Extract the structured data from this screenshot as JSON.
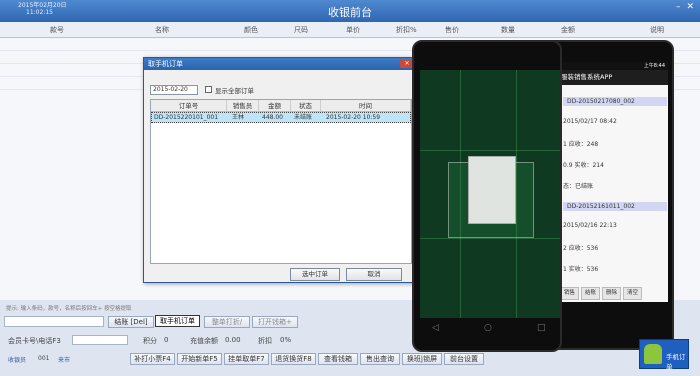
{
  "window": {
    "date": "2015年02月20日",
    "time": "11:02:15",
    "title": "收银前台"
  },
  "grid": {
    "columns": [
      "款号",
      "名称",
      "颜色",
      "尺码",
      "单价",
      "折扣%",
      "售价",
      "数量",
      "金额",
      "说明"
    ]
  },
  "footer": {
    "search_hint": "提示: 输入条码，款号，名称后按回车+ 按空格提取",
    "btn_settle": "结账 [Del]",
    "btn_fetch_mobile": "取手机订单",
    "btn_discount": "整单打折/",
    "btn_open_drawer": "打开钱箱+",
    "member_label": "会员卡号\\电话F3",
    "points_label": "积分",
    "points_value": "0",
    "recharge_label": "充值余额",
    "recharge_value": "0.00",
    "discount_label": "折扣",
    "discount_value": "0%",
    "total_label": "件数",
    "total_value": "0",
    "cashier_label": "收银员",
    "cashier_value": "001",
    "shift_label": "来市",
    "actions": [
      "补打小票F4",
      "开始新单F5",
      "挂单取单F7",
      "退货换货F8",
      "查看钱箱",
      "售出查询",
      "换班|锁屏",
      "前台设置"
    ]
  },
  "dialog": {
    "title": "取手机订单",
    "date_value": "2015-02-20",
    "show_all_label": "显示全部订单",
    "headers": [
      "订单号",
      "销售员",
      "金额",
      "状态",
      "时间"
    ],
    "rows": [
      {
        "order": "DD-2015220101_001",
        "seller": "王林",
        "amount": "448.00",
        "status": "未结账",
        "time": "2015-02-20 10:59"
      }
    ],
    "btn_select": "选中订单",
    "btn_cancel": "取消"
  },
  "phone_app": {
    "status_time": "上午8:44",
    "title": "服装销售系统APP",
    "orders": [
      {
        "id": "DD-20150217080_002",
        "date": "2015/02/17 08:42",
        "due_label": "1  应收：248",
        "paid_label": "0.9  实收：214",
        "status_label": "态：已结账"
      },
      {
        "id": "DD-20152161011_002",
        "date": "2015/02/16 22:13",
        "due_label": "2  应收：536",
        "paid_label": "1  实收：536"
      }
    ],
    "tabs": [
      "销售",
      "结账",
      "删除",
      "清空"
    ]
  },
  "badge": {
    "label": "手机订单"
  }
}
